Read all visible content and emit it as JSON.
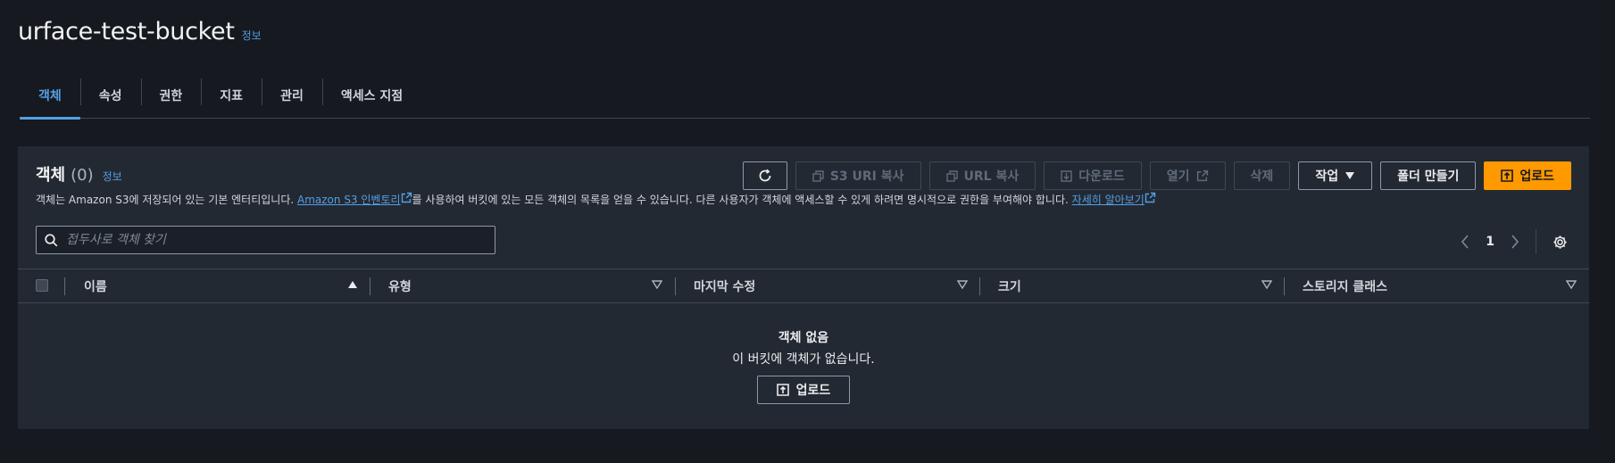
{
  "page": {
    "title": "urface-test-bucket",
    "info": "정보"
  },
  "tabs": [
    {
      "label": "객체",
      "active": true
    },
    {
      "label": "속성",
      "active": false
    },
    {
      "label": "권한",
      "active": false
    },
    {
      "label": "지표",
      "active": false
    },
    {
      "label": "관리",
      "active": false
    },
    {
      "label": "액세스 지점",
      "active": false
    }
  ],
  "objects_panel": {
    "title": "객체",
    "count": "(0)",
    "info": "정보",
    "description_prefix": "객체는 Amazon S3에 저장되어 있는 기본 엔터티입니다. ",
    "inventory_link": "Amazon S3 인벤토리",
    "description_middle": "를 사용하여 버킷에 있는 모든 객체의 목록을 얻을 수 있습니다. 다른 사용자가 객체에 액세스할 수 있게 하려면 명시적으로 권한을 부여해야 합니다. ",
    "learn_more_link": "자세히 알아보기"
  },
  "toolbar": {
    "refresh_icon": "refresh-icon",
    "copy_s3_uri": "S3 URI 복사",
    "copy_url": "URL 복사",
    "download": "다운로드",
    "open": "열기",
    "delete": "삭제",
    "actions": "작업",
    "create_folder": "폴더 만들기",
    "upload": "업로드"
  },
  "search": {
    "placeholder": "접두사로 객체 찾기",
    "value": ""
  },
  "pagination": {
    "current_page": "1"
  },
  "table": {
    "columns": [
      {
        "label": "이름",
        "sort": "ascending"
      },
      {
        "label": "유형",
        "sort": "none"
      },
      {
        "label": "마지막 수정",
        "sort": "none"
      },
      {
        "label": "크기",
        "sort": "none"
      },
      {
        "label": "스토리지 클래스",
        "sort": "none"
      }
    ]
  },
  "empty_state": {
    "title": "객체 없음",
    "description": "이 버킷에 객체가 없습니다.",
    "upload_button": "업로드"
  },
  "colors": {
    "background": "#16191f",
    "panel": "#232932",
    "accent_link": "#539fe5",
    "primary_button": "#ff9900"
  }
}
